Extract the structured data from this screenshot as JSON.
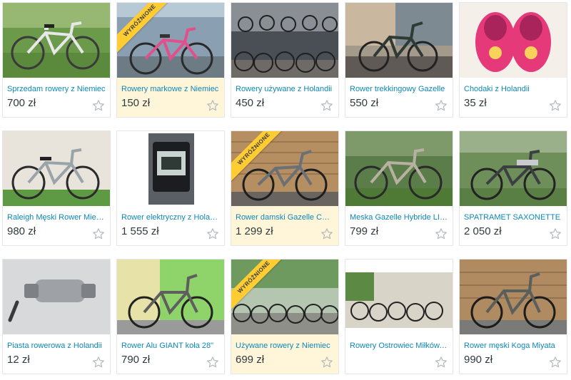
{
  "listings": [
    {
      "title": "Sprzedam rowery z Niemiec",
      "price": "700 zł",
      "featured": false,
      "image": "white-bicycle-photo"
    },
    {
      "title": "Rowery markowe z Niemiec",
      "price": "150 zł",
      "featured": true,
      "badge": "WYRÓŻNIONE",
      "image": "pink-bicycle-photo"
    },
    {
      "title": "Rowery używane z Holandii",
      "price": "450 zł",
      "featured": false,
      "image": "bicycle-shop-photo"
    },
    {
      "title": "Rower trekkingowy Gazelle",
      "price": "550 zł",
      "featured": false,
      "image": "trekking-bicycle-photo"
    },
    {
      "title": "Chodaki z Holandii",
      "price": "35 zł",
      "featured": false,
      "image": "pink-clogs-photo"
    },
    {
      "title": "Raleigh Męski Rower Miejski",
      "price": "980 zł",
      "featured": false,
      "image": "raleigh-bicycle-photo"
    },
    {
      "title": "Rower elektryczny z Holandii",
      "price": "1 555 zł",
      "featured": false,
      "image": "ebike-display-photo"
    },
    {
      "title": "Rower damski Gazelle Chamonix",
      "price": "1 299 zł",
      "featured": true,
      "badge": "WYRÓŻNIONE",
      "image": "gazelle-women-bicycle-photo"
    },
    {
      "title": "Meska Gazelle Hybride LITE",
      "price": "799 zł",
      "featured": false,
      "image": "gazelle-hybrid-photo"
    },
    {
      "title": "SPATRAMET SAXONETTE",
      "price": "2 050 zł",
      "featured": false,
      "image": "saxonette-bicycle-photo"
    },
    {
      "title": "Piasta rowerowa z Holandii",
      "price": "12 zł",
      "featured": false,
      "image": "bicycle-hub-photo"
    },
    {
      "title": "Rower Alu GIANT koła 28\"",
      "price": "790 zł",
      "featured": false,
      "image": "giant-bicycle-photo"
    },
    {
      "title": "Używane rowery z Niemiec",
      "price": "699 zł",
      "featured": true,
      "badge": "WYRÓŻNIONE",
      "image": "used-bicycles-yard-photo"
    },
    {
      "title": "Rowery Ostrowiec Miłków, ...",
      "price": "",
      "featured": false,
      "image": "bicycles-garden-photo"
    },
    {
      "title": "Rower męski Koga Miyata",
      "price": "990 zł",
      "featured": false,
      "image": "koga-bicycle-photo"
    }
  ],
  "icons": {
    "favorite": "star-outline-icon"
  },
  "colors": {
    "title_link": "#0f87b5",
    "price_text": "#2f3b3f",
    "featured_background": "#fff6d9",
    "badge": "#ffcc33",
    "star_outline": "#b5b9bc"
  }
}
